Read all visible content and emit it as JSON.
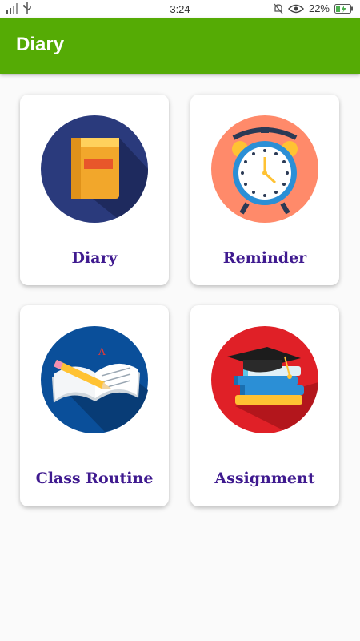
{
  "status_bar": {
    "time": "3:24",
    "battery": "22%",
    "icons": [
      "signal-icon",
      "usb-icon",
      "bell-off-icon",
      "eye-icon",
      "battery-icon"
    ]
  },
  "app_bar": {
    "title": "Diary"
  },
  "cards": [
    {
      "label": "Diary",
      "icon": "book-icon"
    },
    {
      "label": "Reminder",
      "icon": "alarm-clock-icon"
    },
    {
      "label": "Class Routine",
      "icon": "notebook-pencil-icon"
    },
    {
      "label": "Assignment",
      "icon": "graduation-books-icon"
    }
  ],
  "colors": {
    "app_bar": "#55ab05",
    "label_text": "#3f1a8f",
    "diary_icon_bg": "#2a3a7c",
    "reminder_icon_bg": "#ff8a6a",
    "routine_icon_bg": "#0a4f9a",
    "assignment_icon_bg": "#e02027"
  }
}
